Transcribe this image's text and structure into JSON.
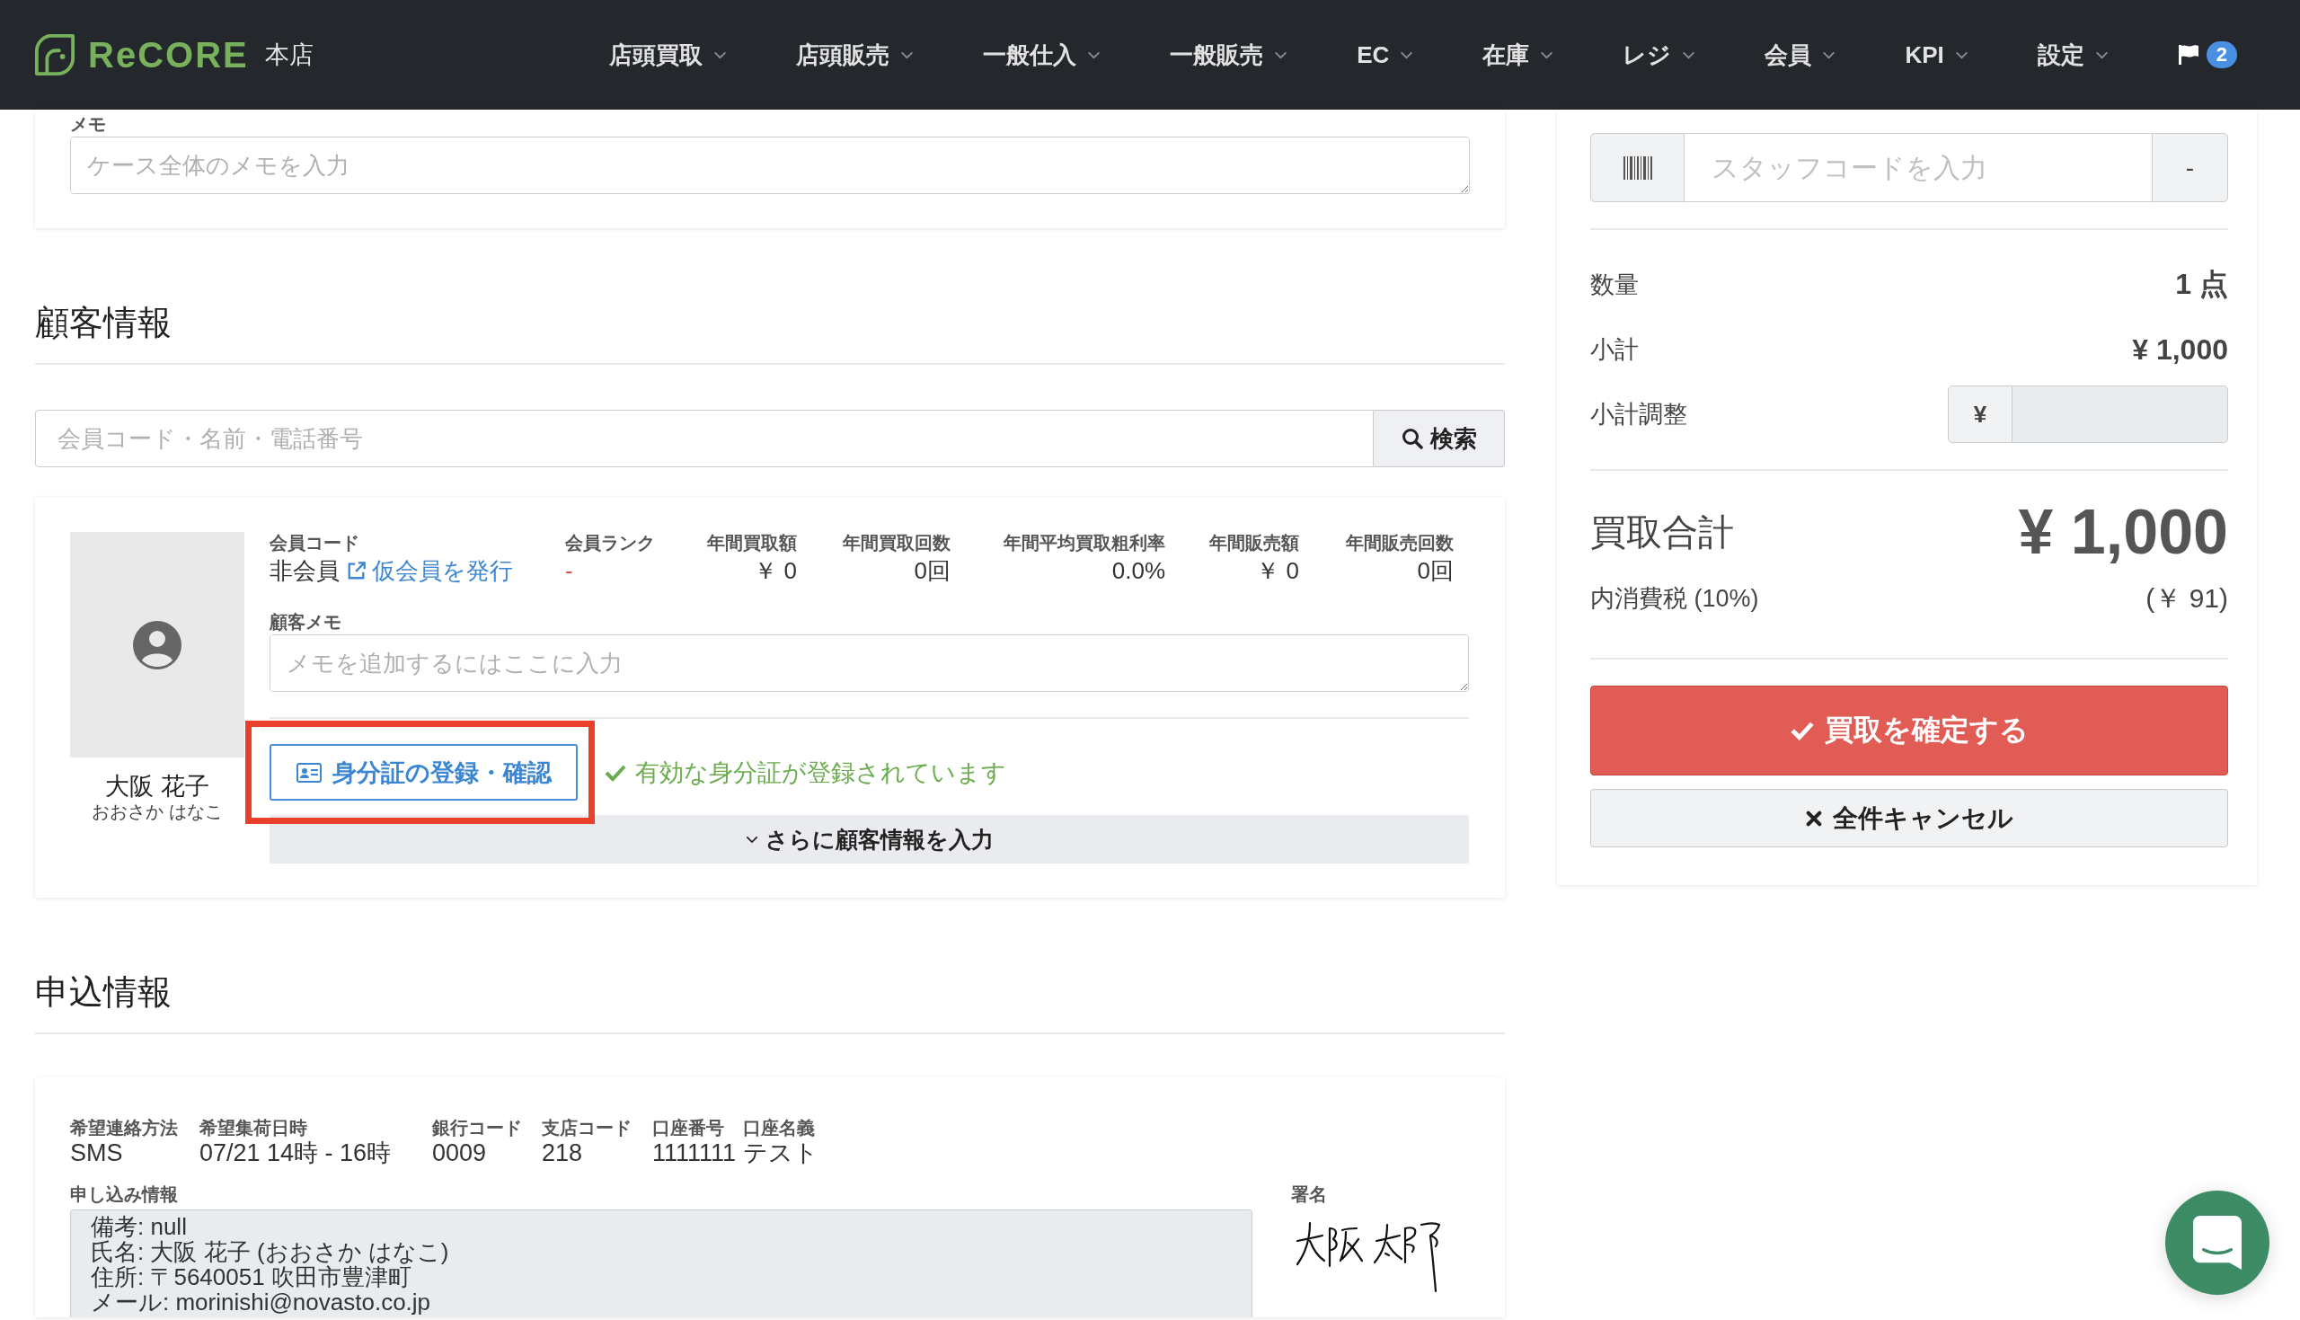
{
  "header": {
    "logo": "ReCORE",
    "store": "本店",
    "nav": [
      {
        "label": "店頭買取"
      },
      {
        "label": "店頭販売"
      },
      {
        "label": "一般仕入"
      },
      {
        "label": "一般販売"
      },
      {
        "label": "EC"
      },
      {
        "label": "在庫"
      },
      {
        "label": "レジ"
      },
      {
        "label": "会員"
      },
      {
        "label": "KPI"
      },
      {
        "label": "設定"
      }
    ],
    "notifications": {
      "count": "2"
    }
  },
  "case_memo": {
    "label": "メモ",
    "placeholder": "ケース全体のメモを入力"
  },
  "customer": {
    "heading": "顧客情報",
    "search": {
      "placeholder": "会員コード・名前・電話番号",
      "button": "検索"
    },
    "name": "大阪 花子",
    "kana": "おおさか はなこ",
    "stats": [
      {
        "kind": "member",
        "label": "会員コード",
        "value": "非会員",
        "link": "仮会員を発行"
      },
      {
        "kind": "rank",
        "label": "会員ランク",
        "value": "-"
      },
      {
        "kind": "number",
        "label": "年間買取額",
        "value": "￥ 0"
      },
      {
        "kind": "number",
        "label": "年間買取回数",
        "value": "0回"
      },
      {
        "kind": "number",
        "label": "年間平均買取粗利率",
        "value": "0.0%"
      },
      {
        "kind": "number",
        "label": "年間販売額",
        "value": "￥ 0"
      },
      {
        "kind": "number",
        "label": "年間販売回数",
        "value": "0回"
      }
    ],
    "memo": {
      "label": "顧客メモ",
      "placeholder": "メモを追加するにはここに入力"
    },
    "id_button": {
      "label": "身分証の登録・確認",
      "highlighted": true
    },
    "id_status": "有効な身分証が登録されています",
    "more_button": "さらに顧客情報を入力"
  },
  "application": {
    "heading": "申込情報",
    "fields": [
      {
        "label": "希望連絡方法",
        "value": "SMS"
      },
      {
        "label": "希望集荷日時",
        "value": "07/21 14時 - 16時"
      },
      {
        "label": "銀行コード",
        "value": "0009"
      },
      {
        "label": "支店コード",
        "value": "218"
      },
      {
        "label": "口座番号",
        "value": "1111111"
      },
      {
        "label": "口座名義",
        "value": "テスト"
      }
    ],
    "details": {
      "label": "申し込み情報",
      "lines": [
        "備考: null",
        "氏名: 大阪 花子 (おおさか はなこ)",
        "住所: 〒5640051 吹田市豊津町",
        "メール: morinishi@novasto.co.jp"
      ]
    },
    "signature": {
      "label": "署名"
    }
  },
  "summary": {
    "staff_code": {
      "placeholder": "スタッフコードを入力",
      "button": "-"
    },
    "rows": [
      {
        "label": "数量",
        "value": "1 点"
      },
      {
        "label": "小計",
        "value": "¥ 1,000"
      }
    ],
    "adjustment": {
      "label": "小計調整",
      "prefix": "¥",
      "disabled": true
    },
    "total": {
      "label": "買取合計",
      "value": "¥ 1,000"
    },
    "tax": {
      "label": "内消費税 (10%)",
      "value": "(￥ 91)"
    },
    "confirm_button": "買取を確定する",
    "cancel_button": "全件キャンセル"
  }
}
